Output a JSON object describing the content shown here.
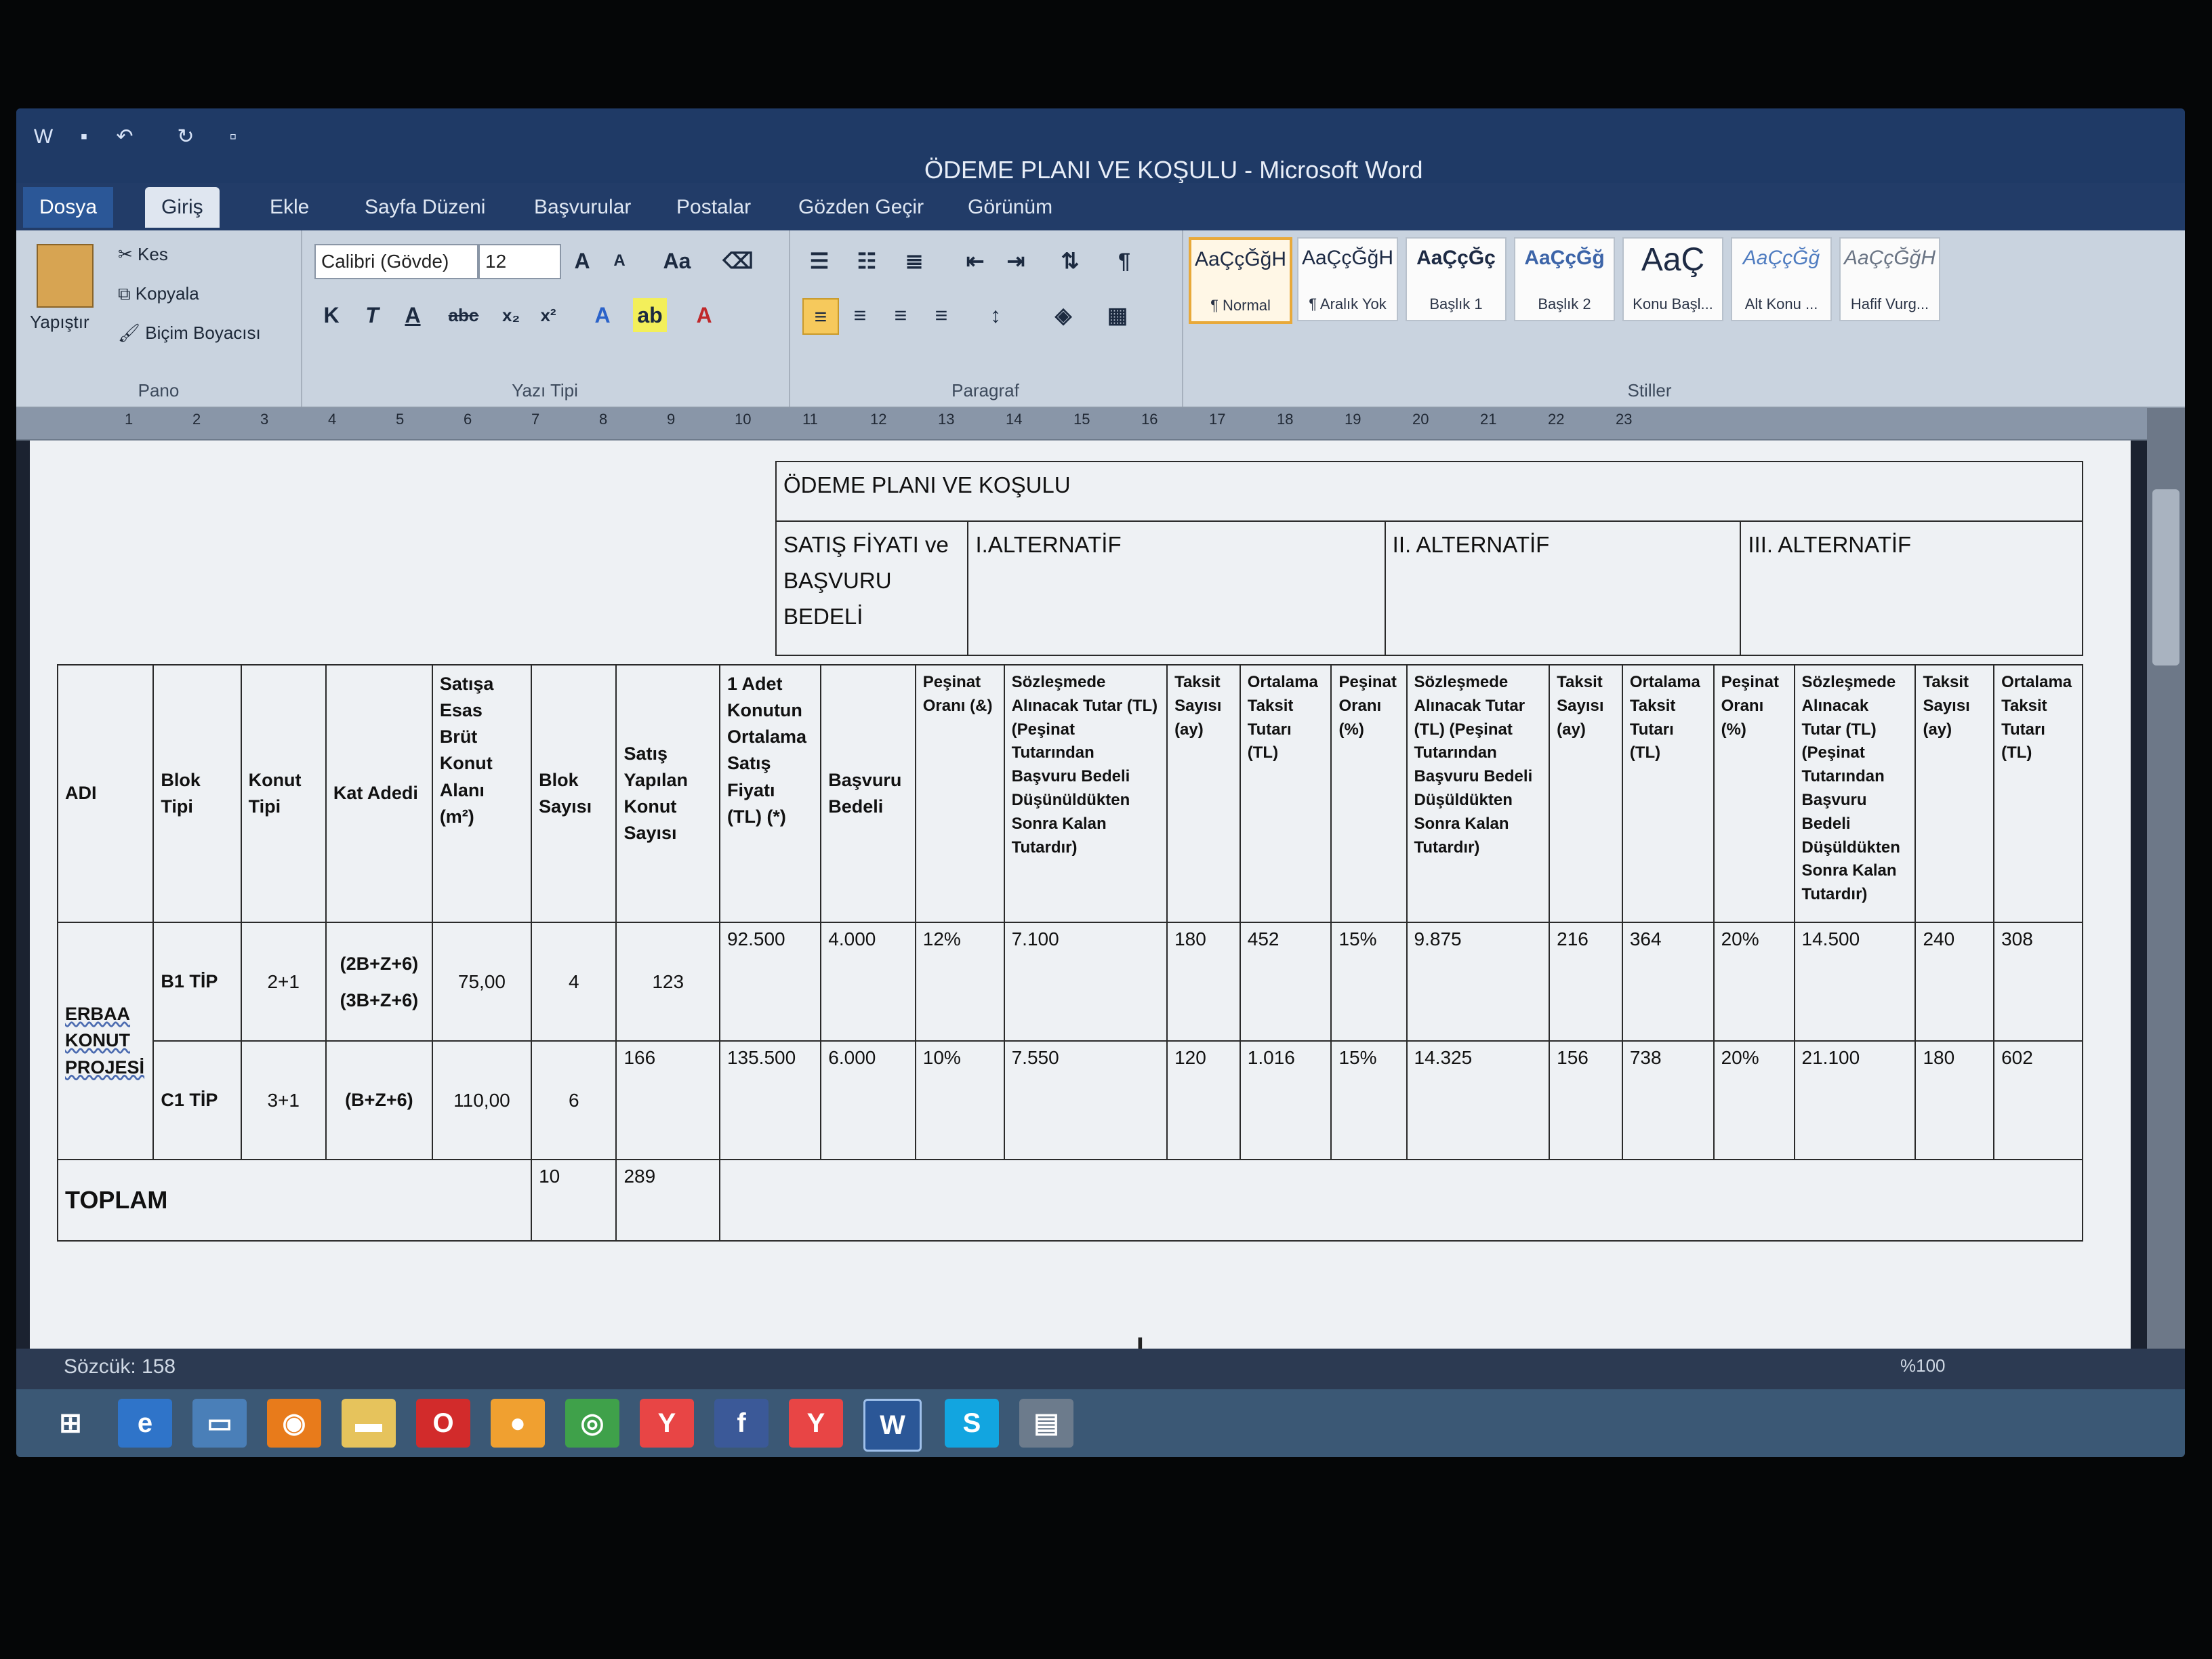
{
  "window": {
    "title": "ÖDEME PLANI VE KOŞULU - Microsoft Word"
  },
  "tabs": [
    "Dosya",
    "Giriş",
    "Ekle",
    "Sayfa Düzeni",
    "Başvurular",
    "Postalar",
    "Gözden Geçir",
    "Görünüm"
  ],
  "ribbon": {
    "clipboard": {
      "paste": "Yapıştır",
      "cut": "Kes",
      "copy": "Kopyala",
      "painter": "Biçim Boyacısı",
      "label": "Pano"
    },
    "font": {
      "name": "Calibri (Gövde)",
      "size": "12",
      "bold": "K",
      "italic": "T",
      "underline": "A",
      "strike": "abc",
      "sub": "x₂",
      "sup": "x²",
      "label": "Yazı Tipi"
    },
    "paragraph": {
      "label": "Paragraf"
    },
    "styles": {
      "items": [
        {
          "sample": "AaÇçĞğH",
          "name": "¶ Normal"
        },
        {
          "sample": "AaÇçĞğH",
          "name": "¶ Aralık Yok"
        },
        {
          "sample": "AaÇçĞç",
          "name": "Başlık 1"
        },
        {
          "sample": "AaÇçĞğ",
          "name": "Başlık 2"
        },
        {
          "sample": "AaÇ",
          "name": "Konu Başl..."
        },
        {
          "sample": "AaÇçĞğ",
          "name": "Alt Konu ..."
        },
        {
          "sample": "AaÇçĞğH",
          "name": "Hafif Vurg..."
        }
      ],
      "label": "Stiller"
    }
  },
  "ruler": [
    "1",
    "2",
    "3",
    "4",
    "5",
    "6",
    "7",
    "8",
    "9",
    "10",
    "11",
    "12",
    "13",
    "14",
    "15",
    "16",
    "17",
    "18",
    "19",
    "20",
    "21",
    "22",
    "23"
  ],
  "table": {
    "title": "ÖDEME PLANI VE KOŞULU",
    "group_headers": {
      "price": "SATIŞ FİYATI ve BAŞVURU BEDELİ",
      "alt1": "I.ALTERNATİF",
      "alt2": "II. ALTERNATİF",
      "alt3": "III. ALTERNATİF"
    },
    "columns": {
      "adi": "ADI",
      "blok_tipi": "Blok Tipi",
      "konut_tipi": "Konut Tipi",
      "kat_adedi": "Kat Adedi",
      "alan": "Satışa Esas Brüt Konut Alanı (m²)",
      "blok_sayisi": "Blok Sayısı",
      "satis": "Satış Yapılan Konut Sayısı",
      "fiyat": "1 Adet Konutun Ortalama Satış Fiyatı (TL) (*)",
      "basvuru": "Başvuru Bedeli",
      "a1_pesinat": "Peşinat Oranı (&)",
      "a1_sozlesme": "Sözleşmede Alınacak Tutar (TL) (Peşinat Tutarından Başvuru Bedeli Düşünüldükten Sonra Kalan Tutardır)",
      "a1_taksit": "Taksit Sayısı (ay)",
      "a1_ort": "Ortalama Taksit Tutarı (TL)",
      "a2_pesinat": "Peşinat Oranı (%)",
      "a2_sozlesme": "Sözleşmede Alınacak Tutar (TL) (Peşinat Tutarından Başvuru Bedeli Düşüldükten Sonra Kalan Tutardır)",
      "a2_taksit": "Taksit Sayısı (ay)",
      "a2_ort": "Ortalama Taksit Tutarı (TL)",
      "a3_pesinat": "Peşinat Oranı (%)",
      "a3_sozlesme": "Sözleşmede Alınacak Tutar (TL) (Peşinat Tutarından Başvuru Bedeli Düşüldükten Sonra Kalan Tutardır)",
      "a3_taksit": "Taksit Sayısı (ay)",
      "a3_ort": "Ortalama Taksit Tutarı (TL)"
    },
    "project": "ERBAA KONUT PROJESİ",
    "rows": [
      {
        "blok": "B1 TİP",
        "konut": "2+1",
        "kat": "(2B+Z+6) (3B+Z+6)",
        "alan": "75,00",
        "blok_sayisi": "4",
        "satis": "123",
        "fiyat": "92.500",
        "basvuru": "4.000",
        "a1_pesinat": "12%",
        "a1_soz": "7.100",
        "a1_taksit": "180",
        "a1_ort": "452",
        "a2_pesinat": "15%",
        "a2_soz": "9.875",
        "a2_taksit": "216",
        "a2_ort": "364",
        "a3_pesinat": "20%",
        "a3_soz": "14.500",
        "a3_taksit": "240",
        "a3_ort": "308"
      },
      {
        "blok": "C1 TİP",
        "konut": "3+1",
        "kat": "(B+Z+6)",
        "alan": "110,00",
        "blok_sayisi": "6",
        "satis": "166",
        "fiyat": "135.500",
        "basvuru": "6.000",
        "a1_pesinat": "10%",
        "a1_soz": "7.550",
        "a1_taksit": "120",
        "a1_ort": "1.016",
        "a2_pesinat": "15%",
        "a2_soz": "14.325",
        "a2_taksit": "156",
        "a2_ort": "738",
        "a3_pesinat": "20%",
        "a3_soz": "21.100",
        "a3_taksit": "180",
        "a3_ort": "602"
      }
    ],
    "total": {
      "label": "TOPLAM",
      "blok": "10",
      "satis": "289"
    }
  },
  "status": {
    "word_count": "Sözcük: 158",
    "zoom": "%100"
  },
  "colors": {
    "word_blue": "#2b5797",
    "ribbon": "#c9d3df",
    "selected_style": "#e8a93a"
  }
}
